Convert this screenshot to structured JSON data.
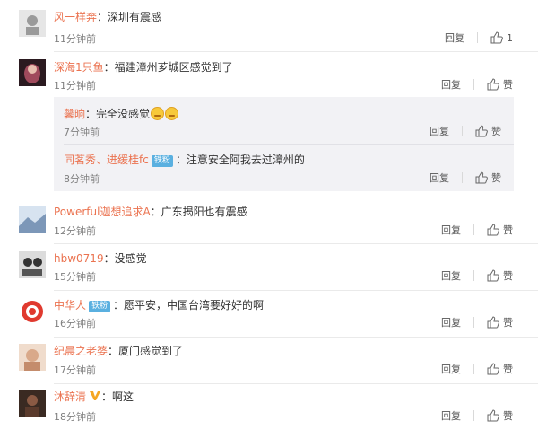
{
  "comments": [
    {
      "user": "风一样奔",
      "colon": "：",
      "text": "深圳有震感",
      "time": "11分钟前",
      "reply": "回复",
      "like": "1",
      "avatar_color": "#bfbfbf"
    },
    {
      "user": "深海1只鱼",
      "colon": "：",
      "text": "福建漳州芗城区感觉到了",
      "time": "11分钟前",
      "reply": "回复",
      "like": "赞",
      "avatar_color": "#8a3b4d"
    },
    {
      "user": "Powerful迦想追求A",
      "colon": "：",
      "text": "广东揭阳也有震感",
      "time": "12分钟前",
      "reply": "回复",
      "like": "赞",
      "avatar_color": "#8fa9c8"
    },
    {
      "user": "hbw0719",
      "colon": "：",
      "text": "没感觉",
      "time": "15分钟前",
      "reply": "回复",
      "like": "赞",
      "avatar_color": "#555555"
    },
    {
      "user": "中华人",
      "badge": "铁粉",
      "colon": "：",
      "text": "愿平安，中国台湾要好好的啊",
      "time": "16分钟前",
      "reply": "回复",
      "like": "赞",
      "avatar_color": "#e03a2f"
    },
    {
      "user": "纪晨之老婆",
      "colon": "：",
      "text": "厦门感觉到了",
      "time": "17分钟前",
      "reply": "回复",
      "like": "赞",
      "avatar_color": "#d9a98a"
    },
    {
      "user": "沐辞清",
      "verified": true,
      "colon": "：",
      "text": "啊这",
      "time": "18分钟前",
      "reply": "回复",
      "like": "赞",
      "avatar_color": "#5a3a2c"
    }
  ],
  "sub_replies": [
    {
      "user": "馨晌",
      "colon": "：",
      "text": "完全没感觉",
      "emojis": 2,
      "time": "7分钟前",
      "reply": "回复",
      "like": "赞"
    },
    {
      "user": "同茗秀、进缓桂fc",
      "badge": "铁粉",
      "colon": "：",
      "text": "注意安全阿我去过漳州的",
      "time": "8分钟前",
      "reply": "回复",
      "like": "赞"
    }
  ],
  "colors": {
    "username": "#eb7350",
    "badge": "#5ab0e0",
    "sub_bg": "#f2f2f5"
  }
}
